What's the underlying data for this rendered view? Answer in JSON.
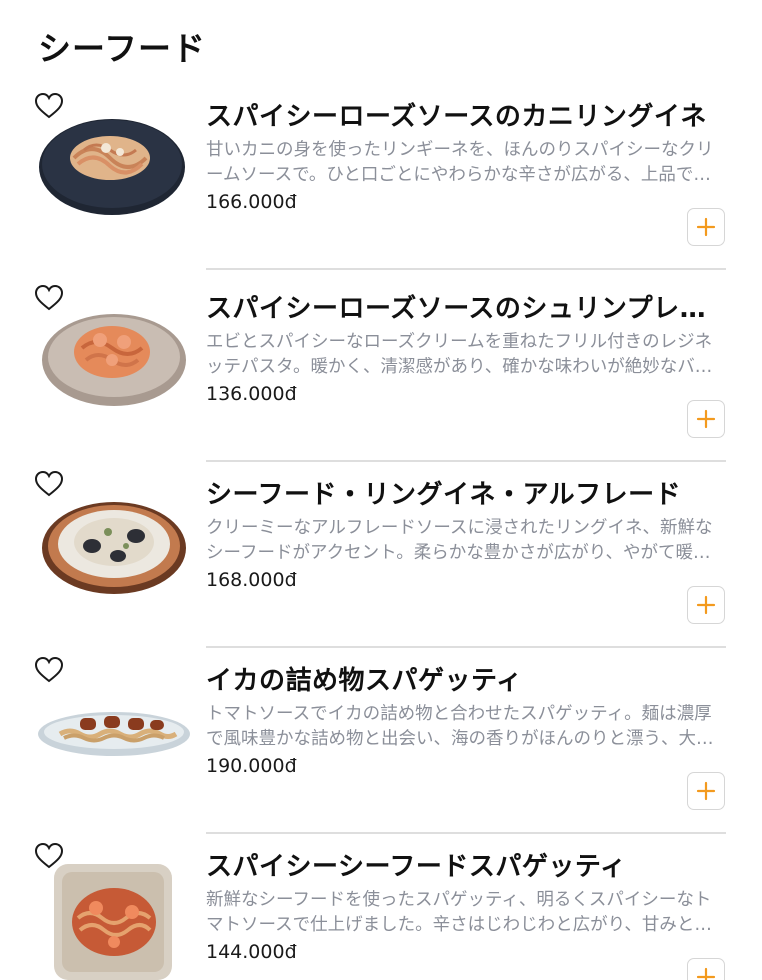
{
  "section": {
    "title": "シーフード"
  },
  "items": [
    {
      "name": "スパイシーローズソースのカニリングイネ",
      "description": "甘いカニの身を使ったリンギーネを、ほんのりスパイシーなクリームソースで。ひと口ごとにやわらかな辛さが広がる、上品で…",
      "price": "166.000đ",
      "plate": "dark"
    },
    {
      "name": "スパイシーローズソースのシュリンプレジネッテ",
      "description": "エビとスパイシーなローズクリームを重ねたフリル付きのレジネッテパスタ。暖かく、清潔感があり、確かな味わいが絶妙なバ…",
      "price": "136.000đ",
      "plate": "taupe"
    },
    {
      "name": "シーフード・リングイネ・アルフレード",
      "description": "クリーミーなアルフレードソースに浸されたリングイネ、新鮮なシーフードがアクセント。柔らかな豊かさが広がり、やがて暖…",
      "price": "168.000đ",
      "plate": "rimmed"
    },
    {
      "name": "イカの詰め物スパゲッティ",
      "description": "トマトソースでイカの詰め物と合わせたスパゲッティ。麺は濃厚で風味豊かな詰め物と出会い、海の香りがほんのりと漂う、大…",
      "price": "190.000đ",
      "plate": "oval"
    },
    {
      "name": "スパイシーシーフードスパゲッティ",
      "description": "新鮮なシーフードを使ったスパゲッティ、明るくスパイシーなトマトソースで仕上げました。辛さはじわじわと広がり、甘みと…",
      "price": "144.000đ",
      "plate": "square"
    }
  ],
  "icons": {
    "favorite": "heart-outline-icon",
    "add": "plus-icon"
  },
  "colors": {
    "accent": "#f39a1e",
    "description": "#8b8f99",
    "divider": "#dedede"
  }
}
